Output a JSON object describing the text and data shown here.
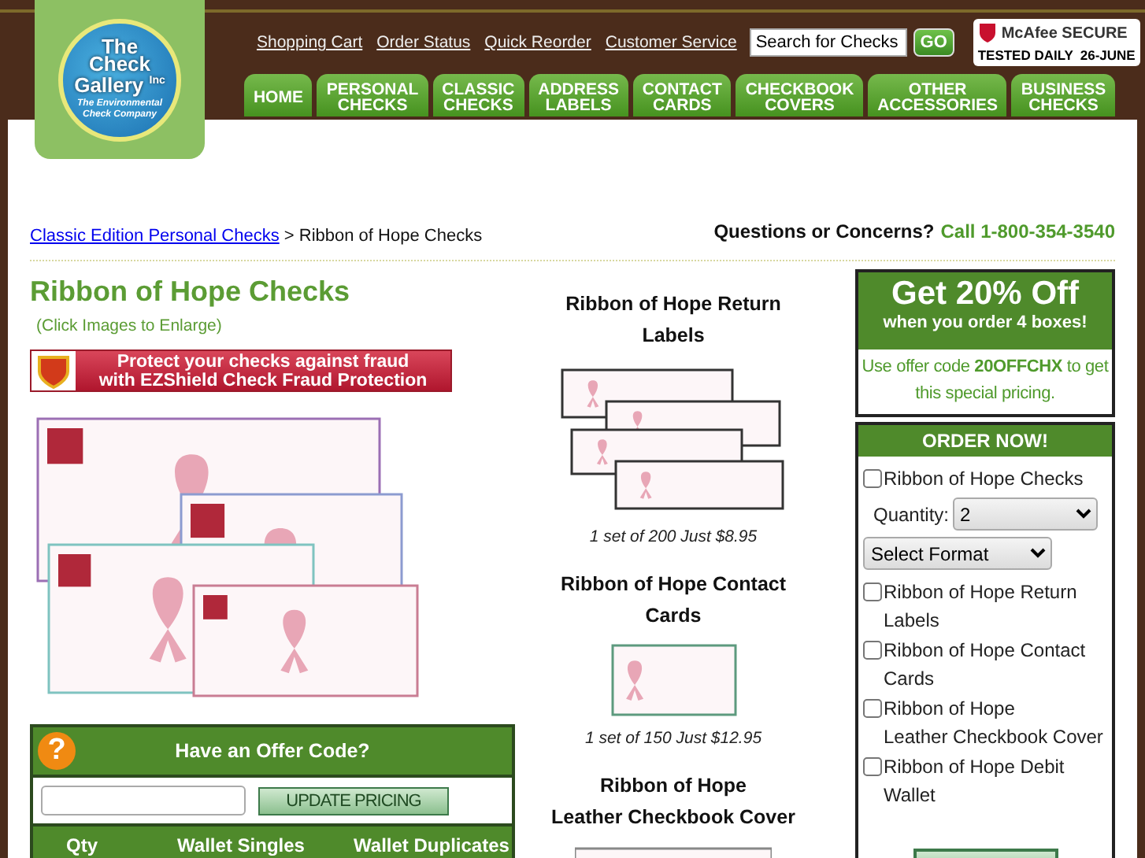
{
  "logo": {
    "title": "The Check Gallery",
    "suffix": "Inc",
    "tagline": "The Environmental Check Company"
  },
  "top_links": [
    "Shopping Cart",
    "Order Status",
    "Quick Reorder",
    "Customer Service"
  ],
  "search": {
    "value": "Search for Checks",
    "button": "GO"
  },
  "security_badge": {
    "brand": "McAfee SECURE",
    "tested": "TESTED DAILY",
    "date": "26-JUNE"
  },
  "nav_tabs": [
    {
      "label": "HOME",
      "selected": false
    },
    {
      "label": "PERSONAL\nCHECKS",
      "selected": false
    },
    {
      "label": "CLASSIC\nCHECKS",
      "selected": false
    },
    {
      "label": "ADDRESS\nLABELS",
      "selected": false
    },
    {
      "label": "CONTACT\nCARDS",
      "selected": false
    },
    {
      "label": "CHECKBOOK\nCOVERS",
      "selected": false
    },
    {
      "label": "OTHER\nACCESSORIES",
      "selected": false
    },
    {
      "label": "BUSINESS\nCHECKS",
      "selected": false
    }
  ],
  "breadcrumb": {
    "link": "Classic Edition Personal Checks",
    "separator": ">",
    "current": "Ribbon of Hope Checks"
  },
  "contact": {
    "question": "Questions or Concerns?",
    "phone": "Call 1-800-354-3540"
  },
  "product": {
    "title": "Ribbon of Hope Checks",
    "hint": "(Click Images to Enlarge)",
    "fraud_banner": "Protect your checks against fraud\nwith EZShield Check Fraud Protection"
  },
  "offer_code": {
    "icon": "?",
    "title": "Have an Offer Code?",
    "button": "UPDATE PRICING",
    "columns": [
      "Qty",
      "Wallet Singles",
      "Wallet Duplicates"
    ]
  },
  "accessories": [
    {
      "title": "Ribbon of Hope Return\nLabels",
      "price": "1 set of 200 Just $8.95"
    },
    {
      "title": "Ribbon of Hope Contact\nCards",
      "price": "1 set of 150 Just $12.95"
    },
    {
      "title": "Ribbon of Hope\nLeather Checkbook Cover"
    }
  ],
  "promo": {
    "headline": "Get 20% Off",
    "subline": "when you order 4 boxes!",
    "note": "Use offer code **20OFFCHX** to get this special pricing."
  },
  "order": {
    "title": "ORDER NOW!",
    "items": [
      {
        "kind": "checkbox",
        "label": "Ribbon of Hope Checks",
        "checked": false
      },
      {
        "kind": "select",
        "label": "Quantity:",
        "value": "2"
      },
      {
        "kind": "select",
        "value": "Select Format"
      },
      {
        "kind": "checkbox",
        "label": "Ribbon of Hope Return Labels",
        "checked": false
      },
      {
        "kind": "checkbox",
        "label": "Ribbon of Hope Contact Cards",
        "checked": false
      },
      {
        "kind": "checkbox",
        "label": "Ribbon of Hope\nLeather Checkbook Cover",
        "checked": false
      },
      {
        "kind": "checkbox",
        "label": "Ribbon of Hope Debit Wallet",
        "checked": false
      }
    ]
  }
}
